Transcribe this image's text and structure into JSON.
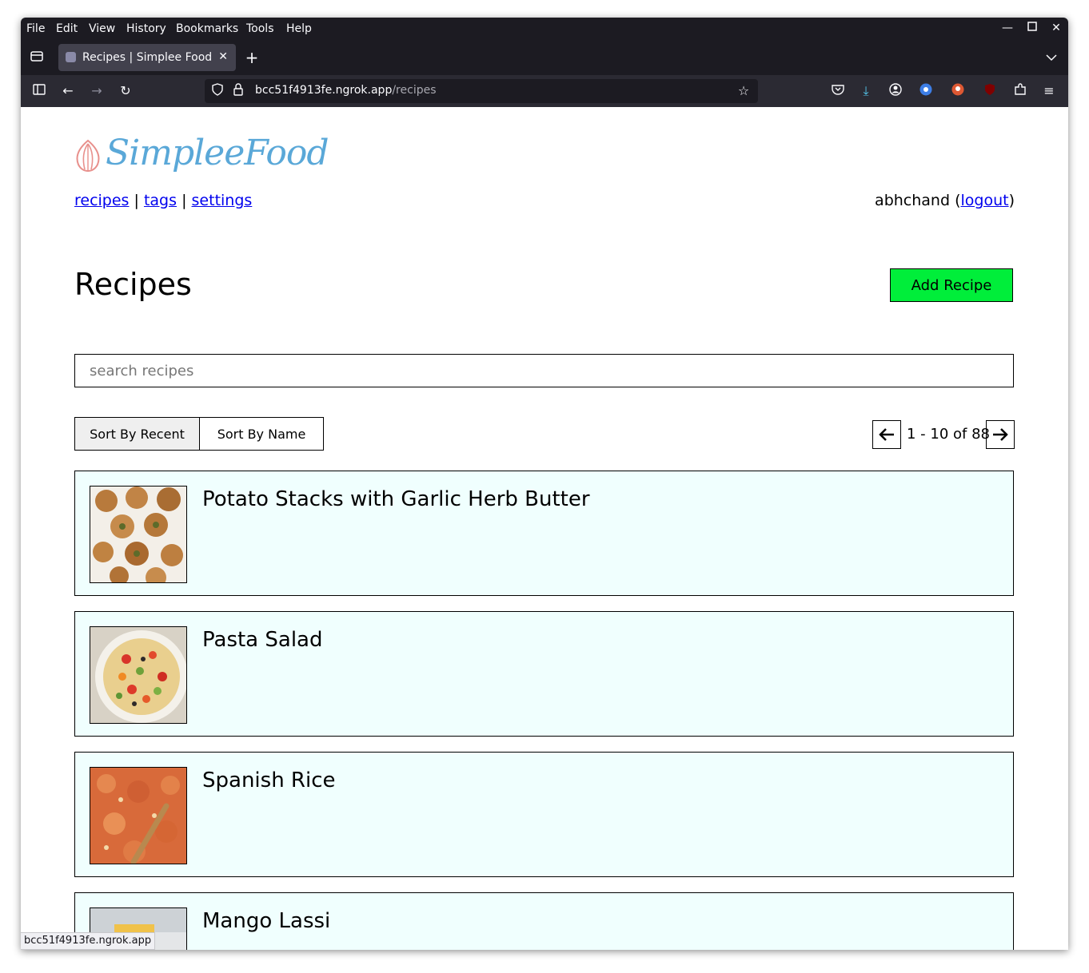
{
  "browser": {
    "menu": [
      "File",
      "Edit",
      "View",
      "History",
      "Bookmarks",
      "Tools",
      "Help"
    ],
    "tab_title": "Recipes | Simplee Food",
    "url_host": "bcc51f4913fe.ngrok.app",
    "url_path": "/recipes",
    "status_url": "bcc51f4913fe.ngrok.app"
  },
  "site": {
    "logo_text": "SimpleeFood",
    "nav": [
      "recipes",
      "tags",
      "settings"
    ],
    "username": "abhchand",
    "logout_label": "logout"
  },
  "main": {
    "heading": "Recipes",
    "add_button": "Add Recipe",
    "search_placeholder": "search recipes",
    "sort_recent": "Sort By Recent",
    "sort_name": "Sort By Name",
    "pagination": "1 - 10 of 88",
    "recipes": [
      {
        "title": "Potato Stacks with Garlic Herb Butter"
      },
      {
        "title": "Pasta Salad"
      },
      {
        "title": "Spanish Rice"
      },
      {
        "title": "Mango Lassi"
      }
    ]
  },
  "colors": {
    "accent_button": "#00ee3a",
    "card_background": "#f0fffe",
    "logo": "#5aa8d8"
  }
}
